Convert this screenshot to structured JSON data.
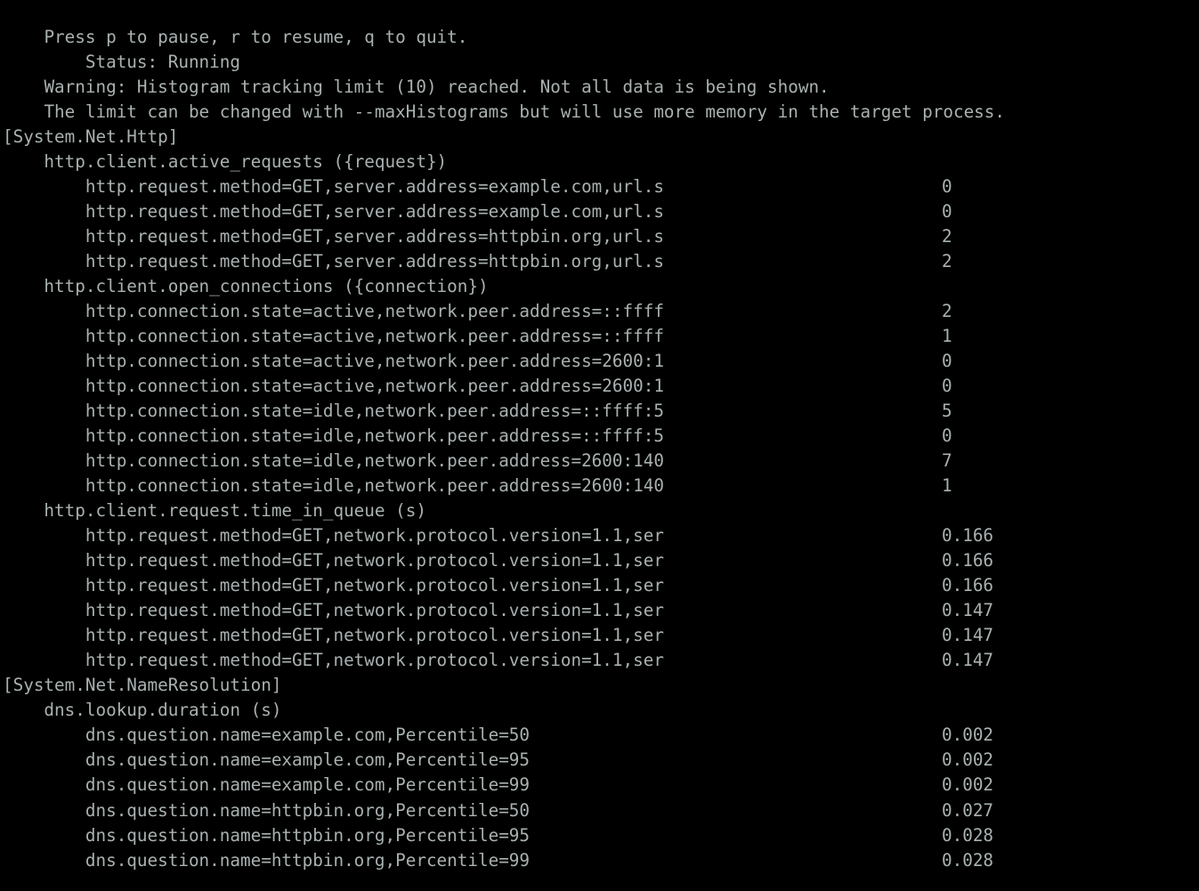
{
  "terminal": {
    "background_color": "#000000",
    "text_color": "#a9b1b1",
    "font_size_px": 19,
    "line_height_px": 28
  },
  "header": {
    "keys_hint": "Press p to pause, r to resume, q to quit.",
    "status_line": "    Status: Running",
    "warning_line_1": "Warning: Histogram tracking limit (10) reached. Not all data is being shown.",
    "warning_line_2": "The limit can be changed with --maxHistograms but will use more memory in the target process."
  },
  "providers": [
    {
      "name": "[System.Net.Http]",
      "metrics": [
        {
          "name": "    http.client.active_requests ({request})",
          "rows": [
            {
              "label": "        http.request.method=GET,server.address=example.com,url.s",
              "value": "0"
            },
            {
              "label": "        http.request.method=GET,server.address=example.com,url.s",
              "value": "0"
            },
            {
              "label": "        http.request.method=GET,server.address=httpbin.org,url.s",
              "value": "2"
            },
            {
              "label": "        http.request.method=GET,server.address=httpbin.org,url.s",
              "value": "2"
            }
          ]
        },
        {
          "name": "    http.client.open_connections ({connection})",
          "rows": [
            {
              "label": "        http.connection.state=active,network.peer.address=::ffff",
              "value": "2"
            },
            {
              "label": "        http.connection.state=active,network.peer.address=::ffff",
              "value": "1"
            },
            {
              "label": "        http.connection.state=active,network.peer.address=2600:1",
              "value": "0"
            },
            {
              "label": "        http.connection.state=active,network.peer.address=2600:1",
              "value": "0"
            },
            {
              "label": "        http.connection.state=idle,network.peer.address=::ffff:5",
              "value": "5"
            },
            {
              "label": "        http.connection.state=idle,network.peer.address=::ffff:5",
              "value": "0"
            },
            {
              "label": "        http.connection.state=idle,network.peer.address=2600:140",
              "value": "7"
            },
            {
              "label": "        http.connection.state=idle,network.peer.address=2600:140",
              "value": "1"
            }
          ]
        },
        {
          "name": "    http.client.request.time_in_queue (s)",
          "rows": [
            {
              "label": "        http.request.method=GET,network.protocol.version=1.1,ser",
              "value": "0.166"
            },
            {
              "label": "        http.request.method=GET,network.protocol.version=1.1,ser",
              "value": "0.166"
            },
            {
              "label": "        http.request.method=GET,network.protocol.version=1.1,ser",
              "value": "0.166"
            },
            {
              "label": "        http.request.method=GET,network.protocol.version=1.1,ser",
              "value": "0.147"
            },
            {
              "label": "        http.request.method=GET,network.protocol.version=1.1,ser",
              "value": "0.147"
            },
            {
              "label": "        http.request.method=GET,network.protocol.version=1.1,ser",
              "value": "0.147"
            }
          ]
        }
      ]
    },
    {
      "name": "[System.Net.NameResolution]",
      "metrics": [
        {
          "name": "    dns.lookup.duration (s)",
          "rows": [
            {
              "label": "        dns.question.name=example.com,Percentile=50",
              "value": "0.002"
            },
            {
              "label": "        dns.question.name=example.com,Percentile=95",
              "value": "0.002"
            },
            {
              "label": "        dns.question.name=example.com,Percentile=99",
              "value": "0.002"
            },
            {
              "label": "        dns.question.name=httpbin.org,Percentile=50",
              "value": "0.027"
            },
            {
              "label": "        dns.question.name=httpbin.org,Percentile=95",
              "value": "0.028"
            },
            {
              "label": "        dns.question.name=httpbin.org,Percentile=99",
              "value": "0.028"
            }
          ]
        }
      ]
    }
  ]
}
